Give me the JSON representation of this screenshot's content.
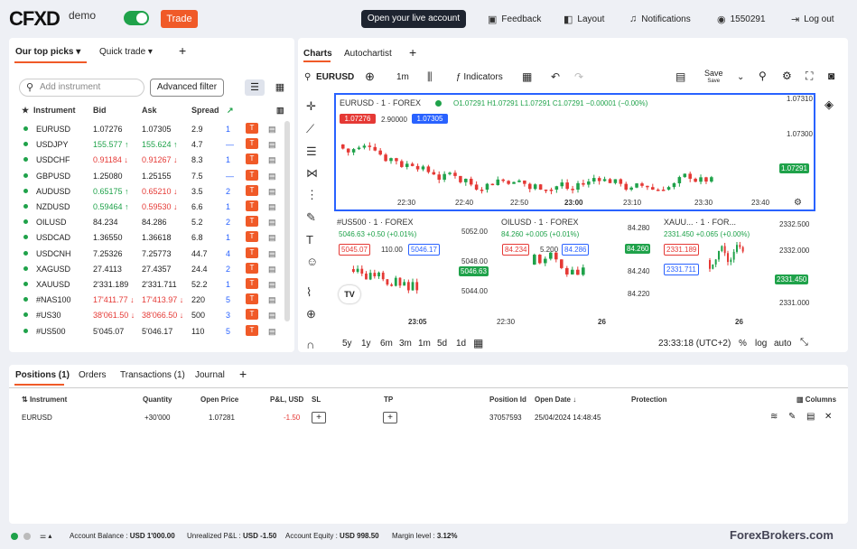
{
  "header": {
    "logo": "CFXD",
    "logo_mode": "demo",
    "trade_button": "Trade",
    "live_account_button": "Open your live account",
    "feedback": "Feedback",
    "layout": "Layout",
    "notifications": "Notifications",
    "account_id": "1550291",
    "logout": "Log out"
  },
  "left_panel": {
    "tabs": [
      "Our top picks",
      "Quick trade"
    ],
    "add_tab": "+",
    "search_placeholder": "Add instrument",
    "advanced_filter": "Advanced filter",
    "columns": {
      "instrument": "Instrument",
      "bid": "Bid",
      "ask": "Ask",
      "spread": "Spread"
    },
    "rows": [
      {
        "name": "EURUSD",
        "bid": "1.07276",
        "ask": "1.07305",
        "spread": "2.9",
        "lev": "1",
        "dir": ""
      },
      {
        "name": "USDJPY",
        "bid": "155.577",
        "ask": "155.624",
        "spread": "4.7",
        "lev": "—",
        "dir": "up"
      },
      {
        "name": "USDCHF",
        "bid": "0.91184",
        "ask": "0.91267",
        "spread": "8.3",
        "lev": "1",
        "dir": "dn"
      },
      {
        "name": "GBPUSD",
        "bid": "1.25080",
        "ask": "1.25155",
        "spread": "7.5",
        "lev": "—",
        "dir": ""
      },
      {
        "name": "AUDUSD",
        "bid": "0.65175",
        "ask": "0.65210",
        "spread": "3.5",
        "lev": "2",
        "dir": "mix"
      },
      {
        "name": "NZDUSD",
        "bid": "0.59464",
        "ask": "0.59530",
        "spread": "6.6",
        "lev": "1",
        "dir": "mix"
      },
      {
        "name": "OILUSD",
        "bid": "84.234",
        "ask": "84.286",
        "spread": "5.2",
        "lev": "2",
        "dir": ""
      },
      {
        "name": "USDCAD",
        "bid": "1.36550",
        "ask": "1.36618",
        "spread": "6.8",
        "lev": "1",
        "dir": ""
      },
      {
        "name": "USDCNH",
        "bid": "7.25326",
        "ask": "7.25773",
        "spread": "44.7",
        "lev": "4",
        "dir": ""
      },
      {
        "name": "XAGUSD",
        "bid": "27.4113",
        "ask": "27.4357",
        "spread": "24.4",
        "lev": "2",
        "dir": ""
      },
      {
        "name": "XAUUSD",
        "bid": "2'331.189",
        "ask": "2'331.711",
        "spread": "52.2",
        "lev": "1",
        "dir": ""
      },
      {
        "name": "#NAS100",
        "bid": "17'411.77",
        "ask": "17'413.97",
        "spread": "220",
        "lev": "5",
        "dir": "dn"
      },
      {
        "name": "#US30",
        "bid": "38'061.50",
        "ask": "38'066.50",
        "spread": "500",
        "lev": "3",
        "dir": "dn"
      },
      {
        "name": "#US500",
        "bid": "5'045.07",
        "ask": "5'046.17",
        "spread": "110",
        "lev": "5",
        "dir": ""
      }
    ],
    "trade_label": "T"
  },
  "charts": {
    "tabs": [
      "Charts",
      "Autochartist"
    ],
    "symbol": "EURUSD",
    "interval": "1m",
    "indicators": "Indicators",
    "save_label": "Save",
    "save_sub": "Save",
    "main": {
      "title": "EURUSD · 1 · FOREX",
      "ohlc": "O1.07291 H1.07291 L1.07291 C1.07291 −0.00001 (−0.00%)",
      "bid_box": "1.07276",
      "spread_box": "2.90000",
      "ask_box": "1.07305",
      "y_ticks": [
        "1.07310",
        "1.07300",
        "1.07291"
      ],
      "x_ticks": [
        "22:30",
        "22:40",
        "22:50",
        "23:00",
        "23:10",
        "23:30",
        "23:40"
      ]
    },
    "us500": {
      "title": "#US500 · 1 · FOREX",
      "change": "5046.63 +0.50 (+0.01%)",
      "bid": "5045.07",
      "spread": "110.00",
      "ask": "5046.17",
      "y_ticks": [
        "5052.00",
        "5048.00",
        "5046.63",
        "5044.00"
      ],
      "x_tick": "23:05"
    },
    "oilusd": {
      "title": "OILUSD · 1 · FOREX",
      "change": "84.260 +0.005 (+0.01%)",
      "bid": "84.234",
      "spread": "5.200",
      "ask": "84.286",
      "y_ticks": [
        "84.280",
        "84.260",
        "84.240",
        "84.220"
      ],
      "x_ticks": [
        "22:30",
        "26"
      ]
    },
    "xauusd": {
      "title": "XAUU... · 1 · FOR...",
      "change": "2331.450 +0.065 (+0.00%)",
      "bid": "2331.189",
      "ask": "2331.711",
      "y_ticks": [
        "2332.500",
        "2332.000",
        "2331.450",
        "2331.000"
      ],
      "x_tick": "26"
    },
    "ranges": [
      "5y",
      "1y",
      "6m",
      "3m",
      "1m",
      "5d",
      "1d"
    ],
    "time": "23:33:18 (UTC+2)",
    "pct": "%",
    "log": "log",
    "auto": "auto"
  },
  "bottom": {
    "tabs": [
      "Positions (1)",
      "Orders",
      "Transactions (1)",
      "Journal"
    ],
    "columns": [
      "Instrument",
      "Quantity",
      "Open Price",
      "P&L, USD",
      "SL",
      "TP",
      "Position Id",
      "Open Date",
      "Protection",
      "Columns"
    ],
    "position": {
      "instrument": "EURUSD",
      "quantity": "+30'000",
      "open_price": "1.07281",
      "pnl": "-1.50",
      "position_id": "37057593",
      "open_date": "25/04/2024 14:48:45"
    }
  },
  "status": {
    "balance_label": "Account Balance :",
    "balance": "USD 1'000.00",
    "unrealized_label": "Unrealized P&L :",
    "unrealized": "USD -1.50",
    "equity_label": "Account Equity :",
    "equity": "USD 998.50",
    "margin_label": "Margin level :",
    "margin": "3.12%"
  },
  "watermark": "ForexBrokers.com"
}
